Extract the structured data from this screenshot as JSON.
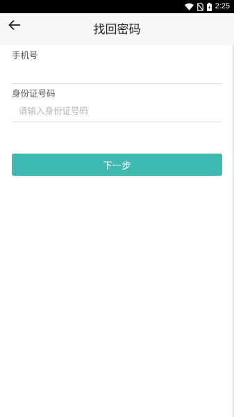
{
  "status_bar": {
    "time": "2:25",
    "icons": [
      "wifi-icon",
      "no-sim-icon",
      "battery-icon"
    ]
  },
  "header": {
    "title": "找回密码",
    "back_icon": "arrow-left-icon"
  },
  "form": {
    "phone": {
      "label": "手机号",
      "value": "",
      "placeholder": ""
    },
    "id_card": {
      "label": "身份证号码",
      "value": "",
      "placeholder": "请输入身份证号码"
    }
  },
  "actions": {
    "next_label": "下一步"
  },
  "colors": {
    "accent": "#3fbab2",
    "app_bar_bg": "#f7f7f7",
    "status_bar_bg": "#000000",
    "divider": "#d8d8d8"
  }
}
